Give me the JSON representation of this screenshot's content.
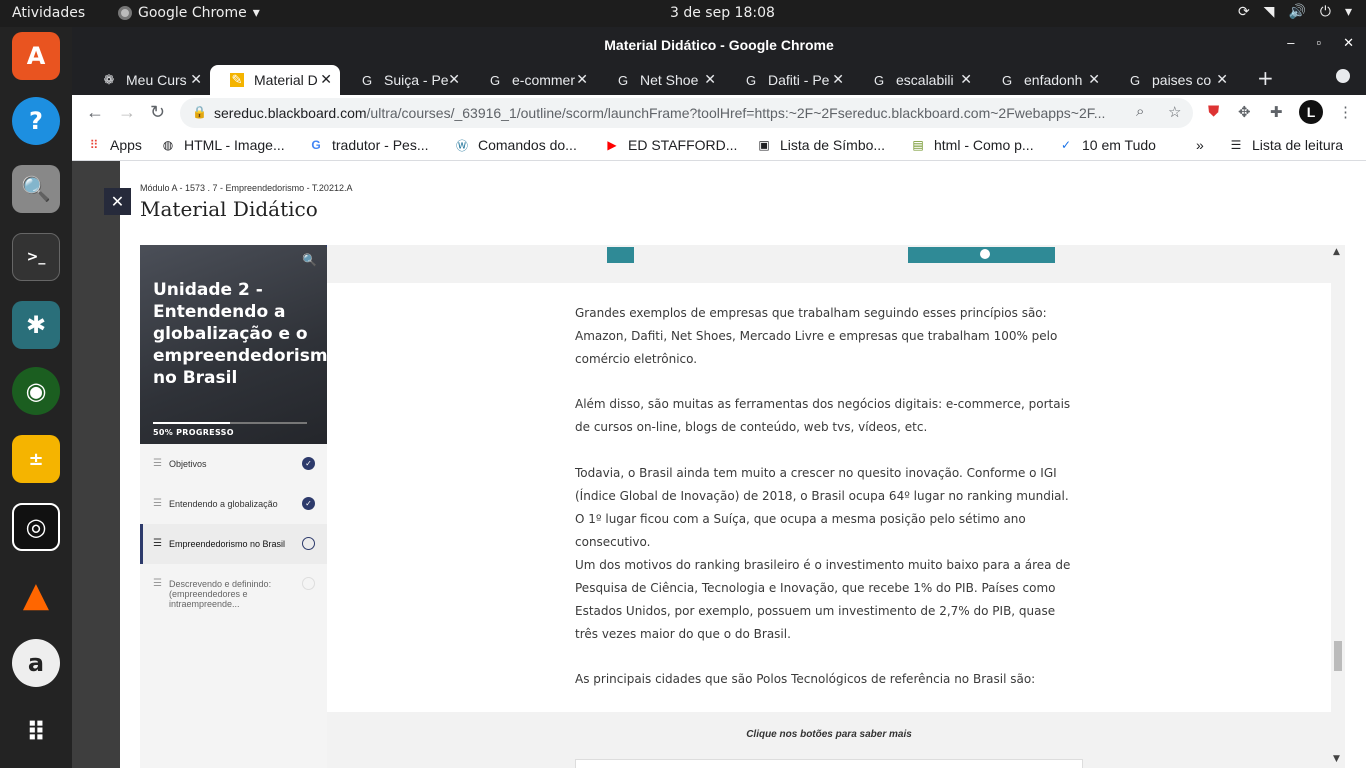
{
  "system": {
    "activities": "Atividades",
    "app_name": "Google Chrome",
    "clock": "3 de sep  18:08"
  },
  "window": {
    "title": "Material Didático - Google Chrome"
  },
  "tabs": [
    {
      "label": "Meu Curs",
      "icon": "puzzle-icon"
    },
    {
      "label": "Material D",
      "icon": "pencil-icon",
      "active": true
    },
    {
      "label": "Suiça - Pe",
      "icon": "google-icon"
    },
    {
      "label": "e-commer",
      "icon": "google-icon"
    },
    {
      "label": "Net Shoe",
      "icon": "google-icon"
    },
    {
      "label": "Dafiti - Pe",
      "icon": "google-icon"
    },
    {
      "label": "escalabili",
      "icon": "google-icon"
    },
    {
      "label": "enfadonh",
      "icon": "google-icon"
    },
    {
      "label": "paises co",
      "icon": "google-icon"
    }
  ],
  "omnibox": {
    "host": "sereduc.blackboard.com",
    "path": "/ultra/courses/_63916_1/outline/scorm/launchFrame?toolHref=https:~2F~2Fsereduc.blackboard.com~2Fwebapps~2F..."
  },
  "avatar_letter": "L",
  "bookmarks": [
    {
      "label": "Apps",
      "icon": "apps-grid-icon"
    },
    {
      "label": "HTML - Image...",
      "icon": "globe-icon"
    },
    {
      "label": "tradutor - Pes...",
      "icon": "google-icon"
    },
    {
      "label": "Comandos do...",
      "icon": "wordpress-icon"
    },
    {
      "label": "ED STAFFORD...",
      "icon": "youtube-icon"
    },
    {
      "label": "Lista de Símbo...",
      "icon": "doc-icon"
    },
    {
      "label": "html - Como p...",
      "icon": "stackexchange-icon"
    },
    {
      "label": "10 em Tudo",
      "icon": "check-logo-icon"
    }
  ],
  "bookmarks_overflow": "»",
  "reading_list": "Lista de leitura",
  "panel": {
    "breadcrumb": "Módulo A - 1573 . 7 - Empreendedorismo - T.20212.A",
    "title": "Material Didático"
  },
  "course": {
    "unit_title": "Unidade 2 - Entendendo a globalização e o empreendedorismo no Brasil",
    "progress_label": "50% PROGRESSO",
    "progress": 0.5,
    "nav": [
      {
        "label": "Objetivos",
        "state": "done"
      },
      {
        "label": "Entendendo a globalização",
        "state": "done"
      },
      {
        "label": "Empreendedorismo no Brasil",
        "state": "current"
      },
      {
        "label": "Descrevendo e definindo: (empreendedores e intraempreende...",
        "state": "pending"
      }
    ],
    "paragraphs": [
      "Grandes exemplos de empresas que trabalham seguindo esses princípios são: Amazon, Dafiti, Net Shoes, Mercado Livre e empresas que trabalham 100% pelo comércio eletrônico.",
      "Além disso, são muitas as ferramentas dos negócios digitais: e-commerce, portais de cursos on-line, blogs de conteúdo, web tvs, vídeos, etc.",
      "Todavia, o Brasil ainda tem muito a crescer no quesito inovação. Conforme o IGI (Índice Global de Inovação) de 2018, o Brasil ocupa 64º lugar no ranking mundial. O 1º lugar ficou com a Suíça, que ocupa a mesma posição pelo sétimo ano consecutivo.",
      "Um dos motivos do ranking brasileiro é o investimento muito baixo para a área de Pesquisa de Ciência, Tecnologia e Inovação, que recebe 1% do PIB. Países como Estados Unidos, por exemplo, possuem um investimento de 2,7% do PIB, quase três vezes maior do que o do Brasil.",
      "As principais cidades que são Polos Tecnológicos de referência no Brasil são:"
    ],
    "cta": "Clique nos botões para saber mais"
  }
}
